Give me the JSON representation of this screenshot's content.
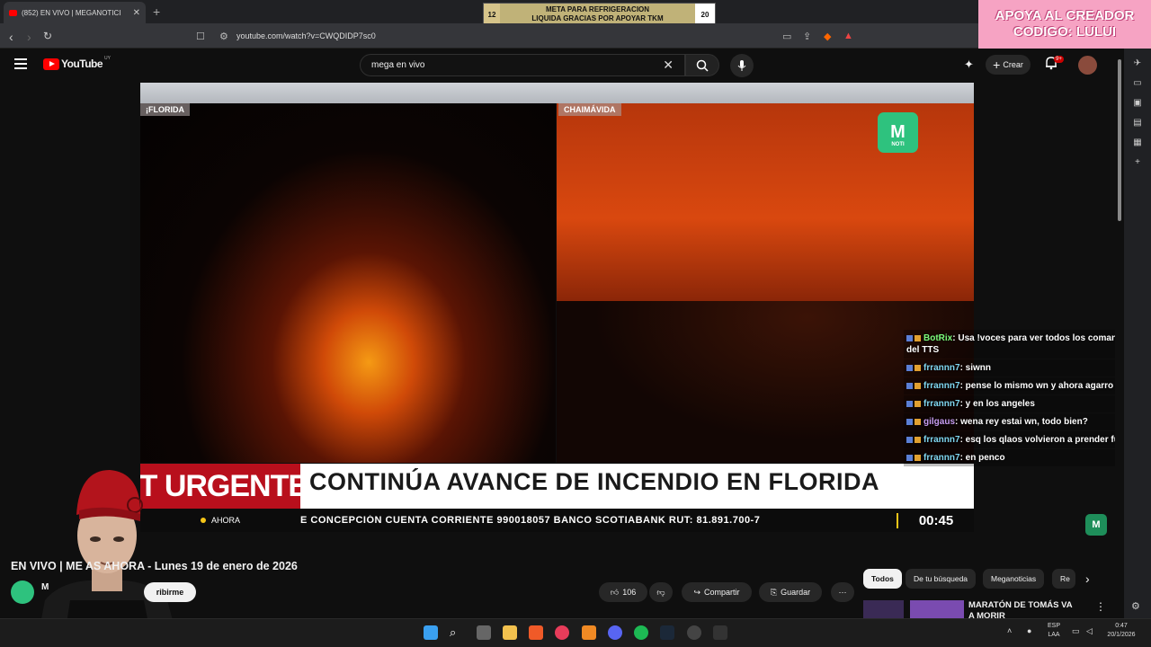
{
  "browser": {
    "tab_title": "(852) EN VIVO | MEGANOTICI",
    "url": "youtube.com/watch?v=CWQDIDP7sc0"
  },
  "stream_overlay": {
    "goal_left": "12",
    "goal_text_1": "META PARA REFRIGERACION",
    "goal_text_2": "LIQUIDA GRACIAS POR APOYAR TKM",
    "goal_right": "20",
    "banner_line1": "APOYA AL CREADOR",
    "banner_line2": "CODIGO: LULUI"
  },
  "youtube": {
    "logo_text": "YouTube",
    "country": "UY",
    "search_value": "mega en vivo",
    "create_label": "Crear",
    "notif_badge": "9+"
  },
  "video": {
    "left_location": "¡FLORIDA",
    "right_location": "CHAIMÁVIDA",
    "logo_caption": "NOTI",
    "urgent_label": "CENT URGENTE E U",
    "headline": "CONTINÚA AVANCE DE INCENDIO EN FLORIDA",
    "ahora_label": "AHORA",
    "ticker": "E CONCEPCIÓN CUENTA CORRIENTE 990018057 BANCO SCOTIABANK RUT: 81.891.700-7",
    "clock": "00:45"
  },
  "chat": [
    {
      "user": "BotRix",
      "color": "#7cfc7c",
      "msg": ": Usa !voces para ver todos los comandos del TTS"
    },
    {
      "user": "frrannn7",
      "color": "#7fd6f0",
      "msg": ": siwnn"
    },
    {
      "user": "frrannn7",
      "color": "#7fd6f0",
      "msg": ": pense lo mismo wn y ahora agarro pa laja"
    },
    {
      "user": "frrannn7",
      "color": "#7fd6f0",
      "msg": ": y en los angeles"
    },
    {
      "user": "gilgaus",
      "color": "#c79cf0",
      "msg": ": wena rey  estai wn, todo bien?"
    },
    {
      "user": "frrannn7",
      "color": "#7fd6f0",
      "msg": ": esq los qlaos volvieron a prender fuego"
    },
    {
      "user": "frrannn7",
      "color": "#7fd6f0",
      "msg": ": en penco"
    }
  ],
  "watch": {
    "title": "EN VIVO | ME          AS AHORA - Lunes 19 de enero de 2026",
    "channel_initial": "M",
    "subscribe_label": "ribirme",
    "likes": "106",
    "share_label": "Compartir",
    "save_label": "Guardar"
  },
  "chips": [
    "Todos",
    "De tu búsqueda",
    "Meganoticias",
    "Re"
  ],
  "related": {
    "title": "MARATÓN DE TOMÁS VA A MORIR"
  },
  "taskbar": {
    "lang_1": "ESP",
    "lang_2": "LAA",
    "time": "0:47",
    "date": "20/1/2026"
  }
}
